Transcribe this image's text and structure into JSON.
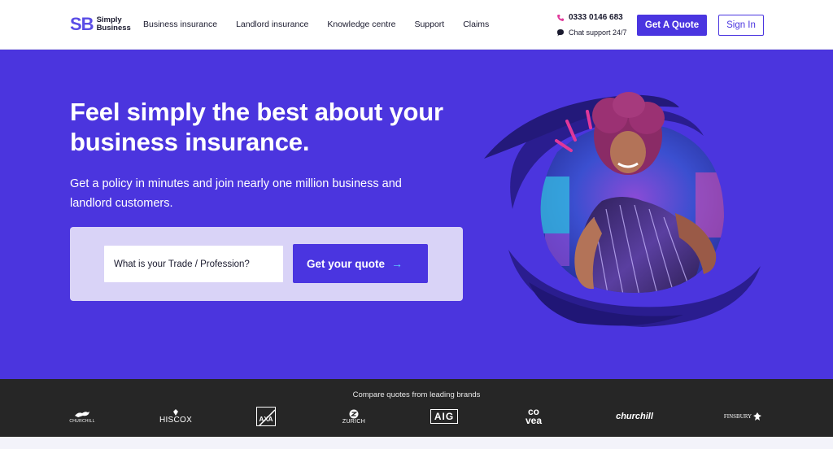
{
  "header": {
    "logo_mark": "SB",
    "logo_line1": "Simply",
    "logo_line2": "Business",
    "nav": [
      {
        "label": "Business insurance"
      },
      {
        "label": "Landlord insurance"
      },
      {
        "label": "Knowledge centre"
      },
      {
        "label": "Support"
      },
      {
        "label": "Claims"
      }
    ],
    "phone": "0333 0146 683",
    "chat": "Chat support 24/7",
    "quote_button": "Get A Quote",
    "signin_button": "Sign In"
  },
  "hero": {
    "headline": "Feel simply the best about your business insurance.",
    "subtext": "Get a policy in minutes and join nearly one million business and landlord customers.",
    "trade_placeholder": "What is your Trade / Profession?",
    "get_quote_label": "Get your quote",
    "arrow": "→"
  },
  "brands": {
    "title": "Compare quotes from leading brands",
    "items": [
      {
        "name": "Churchill Insurance",
        "label": "CHURCHILL"
      },
      {
        "name": "Hiscox",
        "label": "HISCOX"
      },
      {
        "name": "AXA",
        "label": "AXA"
      },
      {
        "name": "Zurich",
        "label": "ZURICH"
      },
      {
        "name": "AIG",
        "label": "AIG"
      },
      {
        "name": "Covea",
        "label": "co vea"
      },
      {
        "name": "Churchill",
        "label": "churchill"
      },
      {
        "name": "Finsbury",
        "label": "FINSBURY"
      }
    ]
  },
  "colors": {
    "brand_purple": "#4b35de",
    "button_purple": "#4a35e0",
    "panel_lilac": "#d9d3f7",
    "brand_bar": "#262626",
    "accent_cyan": "#5fd4ff",
    "accent_pink": "#e0389a"
  }
}
